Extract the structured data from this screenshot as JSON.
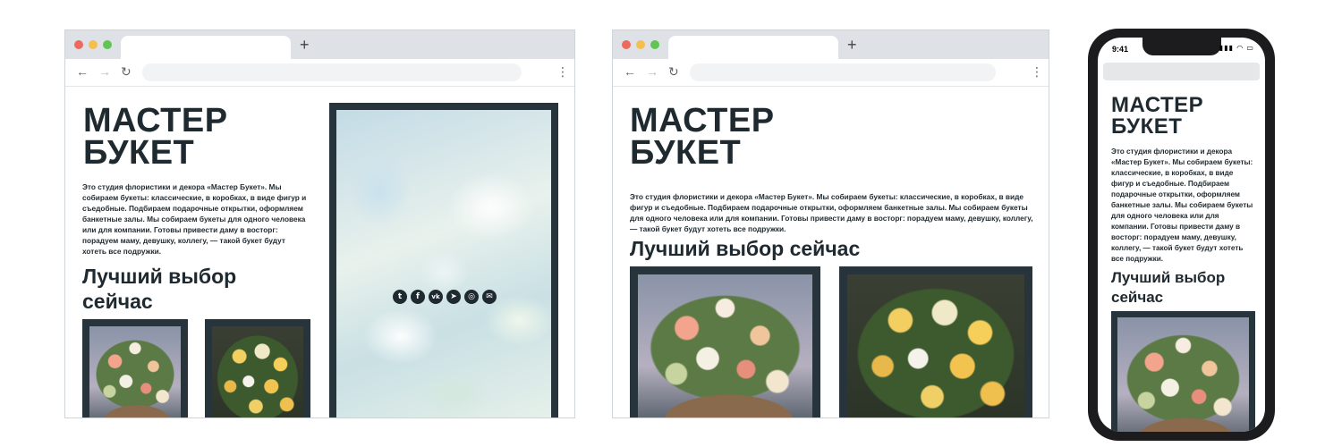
{
  "site": {
    "title_line1": "МАСТЕР",
    "title_line2": "БУКЕТ",
    "description": "Это студия флористики и декора «Мастер Букет». Мы собираем букеты: классические, в коробках, в виде фигур и съедобные. Подбираем подарочные открытки, оформляем банкетные залы. Мы собираем букеты для одного человека или для компании. Готовы привести даму в восторг: порадуем маму, девушку, коллегу, — такой букет будут хотеть все подружки.",
    "section_title": "Лучший выбор сейчас",
    "section_title_wrapped_1": "Лучший выбор",
    "section_title_wrapped_2": "сейчас"
  },
  "browser": {
    "new_tab_label": "+",
    "back_glyph": "←",
    "forward_glyph": "→",
    "reload_glyph": "↻",
    "menu_glyph": "⋮"
  },
  "social_icons": [
    {
      "name": "twitter-icon",
      "glyph": "t"
    },
    {
      "name": "facebook-icon",
      "glyph": "f"
    },
    {
      "name": "vk-icon",
      "glyph": "vk"
    },
    {
      "name": "telegram-icon",
      "glyph": "➤"
    },
    {
      "name": "instagram-icon",
      "glyph": "◎"
    },
    {
      "name": "mail-icon",
      "glyph": "✉"
    }
  ],
  "phone": {
    "time": "9:41",
    "status_icons": "▮▮▮ ◠ ▭"
  },
  "colors": {
    "text": "#1f2a30",
    "frame": "#27343b",
    "tabbar": "#dee1e6"
  }
}
